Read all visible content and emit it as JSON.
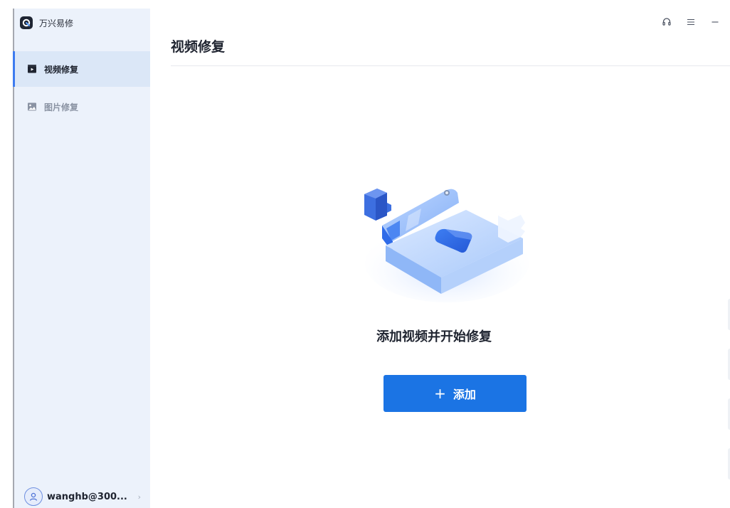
{
  "app": {
    "name": "万兴易修"
  },
  "sidebar": {
    "items": [
      {
        "label": "视频修复",
        "icon": "video-icon",
        "active": true
      },
      {
        "label": "图片修复",
        "icon": "image-icon",
        "active": false
      }
    ],
    "account": {
      "name": "wanghb@300...",
      "icon": "user-icon"
    }
  },
  "window_controls": {
    "icons": [
      "headset-icon",
      "menu-icon",
      "minimize-icon"
    ]
  },
  "main": {
    "title": "视频修复",
    "empty_state": {
      "title": "添加视频并开始修复",
      "button_label": "添加",
      "button_icon": "plus-icon"
    }
  },
  "colors": {
    "accent": "#1b74e4",
    "sidebar_bg": "#ecf2fb",
    "active_item_bg": "#dbe7f7"
  }
}
